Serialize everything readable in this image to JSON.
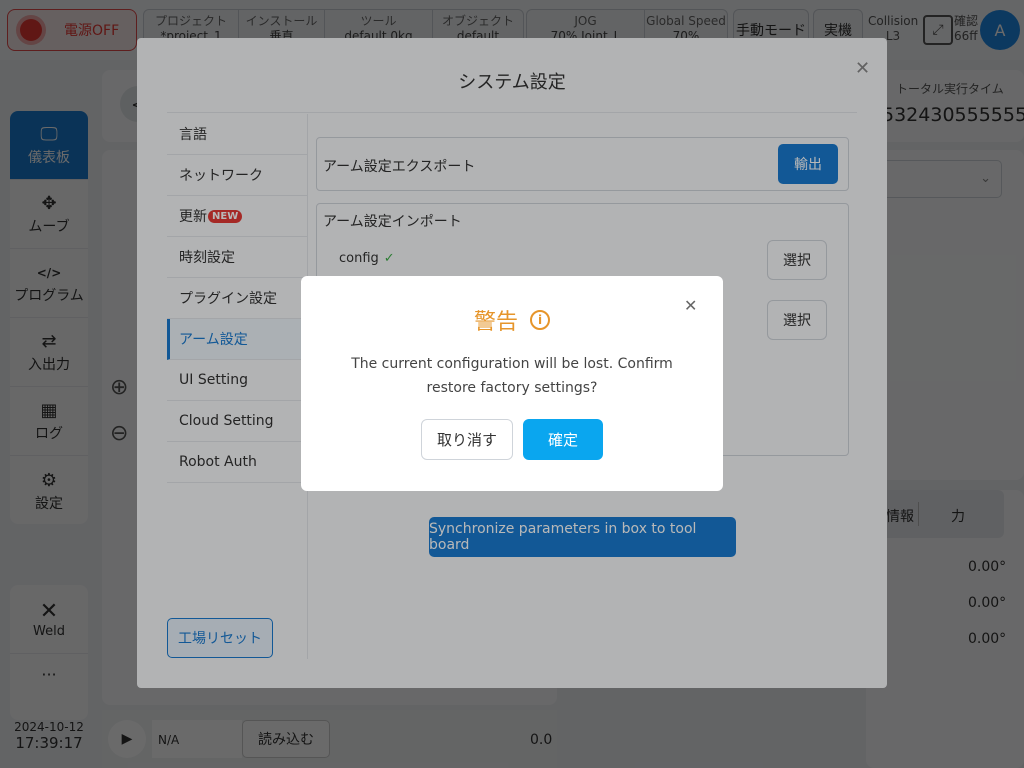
{
  "topbar": {
    "power_label": "電源OFF",
    "group1": [
      {
        "label": "プロジェクト",
        "value": "*project_1"
      },
      {
        "label": "インストール",
        "value": "垂直"
      },
      {
        "label": "ツール",
        "value": "default  0kg"
      },
      {
        "label": "オブジェクト",
        "value": "default"
      }
    ],
    "group2": [
      {
        "label": "JOG",
        "value": "70%  Joint_L"
      },
      {
        "label": "Global Speed",
        "value": "70%"
      }
    ],
    "manual_mode": "手動モード",
    "real_machine": "実機",
    "collision_label": "Collision",
    "collision_value": "L3",
    "confirm_label": "確認",
    "confirm_value": "66ff",
    "avatar": "A"
  },
  "sidebar": {
    "items": [
      {
        "label": "儀表板",
        "icon": "monitor-icon"
      },
      {
        "label": "ムーブ",
        "icon": "move-icon"
      },
      {
        "label": "プログラム",
        "icon": "code-icon"
      },
      {
        "label": "入出力",
        "icon": "swap-icon"
      },
      {
        "label": "ログ",
        "icon": "calendar-icon"
      },
      {
        "label": "設定",
        "icon": "gear-icon"
      }
    ],
    "weld_label": "Weld",
    "more_label": "···"
  },
  "datetime": {
    "date": "2024-10-12",
    "time": "17:39:17"
  },
  "background": {
    "total_time_label": "トータル実行タイム",
    "total_time_value": "532430555555:",
    "tab_info": "情報",
    "tab_force": "力",
    "angles": [
      "0.00°",
      "0.00°",
      "0.00°"
    ],
    "bottom_na": "N/A",
    "load_button": "読み込む",
    "bottom_value": "0.0"
  },
  "system_settings": {
    "title": "システム設定",
    "menu": [
      {
        "label": "言語",
        "badge": ""
      },
      {
        "label": "ネットワーク",
        "badge": ""
      },
      {
        "label": "更新",
        "badge": "NEW"
      },
      {
        "label": "時刻設定",
        "badge": ""
      },
      {
        "label": "プラグイン設定",
        "badge": ""
      },
      {
        "label": "アーム設定",
        "badge": ""
      },
      {
        "label": "UI Setting",
        "badge": ""
      },
      {
        "label": "Cloud Setting",
        "badge": ""
      },
      {
        "label": "Robot Auth",
        "badge": ""
      }
    ],
    "export_label": "アーム設定エクスポート",
    "export_button": "輸出",
    "import_label": "アーム設定インポート",
    "config_label": "config",
    "select_button": "選択",
    "sync_button": "Synchronize parameters in box to tool board",
    "factory_reset": "工場リセット"
  },
  "warning": {
    "title": "警告",
    "message": "The current configuration will be lost. Confirm restore factory settings?",
    "cancel": "取り消す",
    "ok": "確定"
  }
}
